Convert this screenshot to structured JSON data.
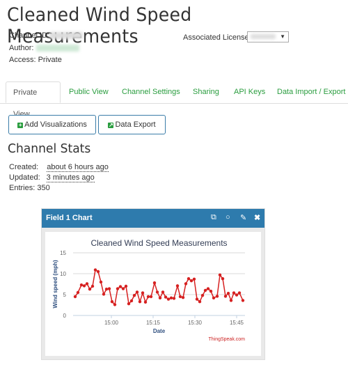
{
  "page": {
    "title": "Cleaned Wind Speed Measurements",
    "channel_id_label": "Channel ID:",
    "author_label": "Author:",
    "access_label": "Access:",
    "access_value": "Private",
    "license_label": "Associated License:"
  },
  "tabs": [
    {
      "label": "Private View",
      "active": true
    },
    {
      "label": "Public View"
    },
    {
      "label": "Channel Settings"
    },
    {
      "label": "Sharing"
    },
    {
      "label": "API Keys"
    },
    {
      "label": "Data Import / Export"
    }
  ],
  "buttons": {
    "add_visualizations": "Add Visualizations",
    "data_export": "Data Export"
  },
  "stats": {
    "title": "Channel Stats",
    "created_label": "Created:",
    "created_value": "about 6 hours ago",
    "updated_label": "Updated:",
    "updated_value": "3 minutes ago",
    "entries_label": "Entries:",
    "entries_value": "350"
  },
  "panel": {
    "title": "Field 1 Chart",
    "icons": [
      "external-link-icon",
      "comment-icon",
      "pencil-icon",
      "close-icon"
    ]
  },
  "colors": {
    "accent_green": "#2a9d3f",
    "panel_header": "#2e7bad",
    "series_red": "#d62020",
    "axis_title_blue": "#2f4f7f"
  },
  "chart_data": {
    "type": "line",
    "title": "Cleaned Wind Speed Measurements",
    "xlabel": "Date",
    "ylabel": "Wind speed (mph)",
    "ylim": [
      0,
      15
    ],
    "yticks": [
      "0",
      "5",
      "10",
      "15"
    ],
    "xticks": [
      "15:00",
      "15:15",
      "15:30",
      "15:45"
    ],
    "xtick_minutes": [
      0,
      15,
      30,
      45
    ],
    "xlim_minutes": [
      -13,
      48
    ],
    "grid": true,
    "credit": "ThingSpeak.com",
    "series": [
      {
        "name": "Field 1",
        "x_minutes": [
          -13,
          -12,
          -10.75,
          -9.75,
          -8.75,
          -7.75,
          -6.75,
          -5.75,
          -4.75,
          -3.75,
          -2.75,
          -1.75,
          -0.75,
          0.25,
          1.25,
          2.25,
          3.25,
          4.25,
          5.25,
          6.25,
          7.25,
          8.25,
          9.25,
          10.25,
          11.25,
          12.25,
          13.25,
          14.25,
          15.5,
          16.5,
          17.5,
          18.5,
          19.5,
          20.5,
          21.5,
          22.5,
          23.75,
          24.75,
          25.75,
          26.75,
          27.75,
          28.75,
          29.75,
          30.75,
          31.75,
          32.75,
          33.75,
          34.75,
          35.75,
          36.75,
          38,
          39,
          40,
          41,
          42,
          43,
          44,
          45,
          46,
          47.25
        ],
        "values": [
          4.5,
          5.5,
          7.3,
          7.1,
          7.6,
          6.3,
          7.0,
          10.9,
          10.5,
          8.0,
          5.1,
          6.3,
          6.4,
          3.3,
          2.6,
          6.4,
          6.9,
          6.4,
          7.0,
          2.8,
          3.5,
          4.8,
          5.6,
          3.3,
          5.4,
          3.2,
          4.5,
          4.5,
          7.8,
          5.6,
          4.2,
          5.6,
          4.4,
          3.9,
          4.2,
          4.1,
          7.1,
          4.5,
          4.3,
          7.6,
          8.8,
          8.3,
          8.7,
          3.9,
          3.3,
          4.8,
          6.0,
          6.4,
          5.8,
          4.2,
          4.6,
          9.7,
          8.8,
          4.6,
          5.3,
          3.6,
          5.4,
          4.9,
          5.4,
          3.6
        ]
      }
    ]
  }
}
